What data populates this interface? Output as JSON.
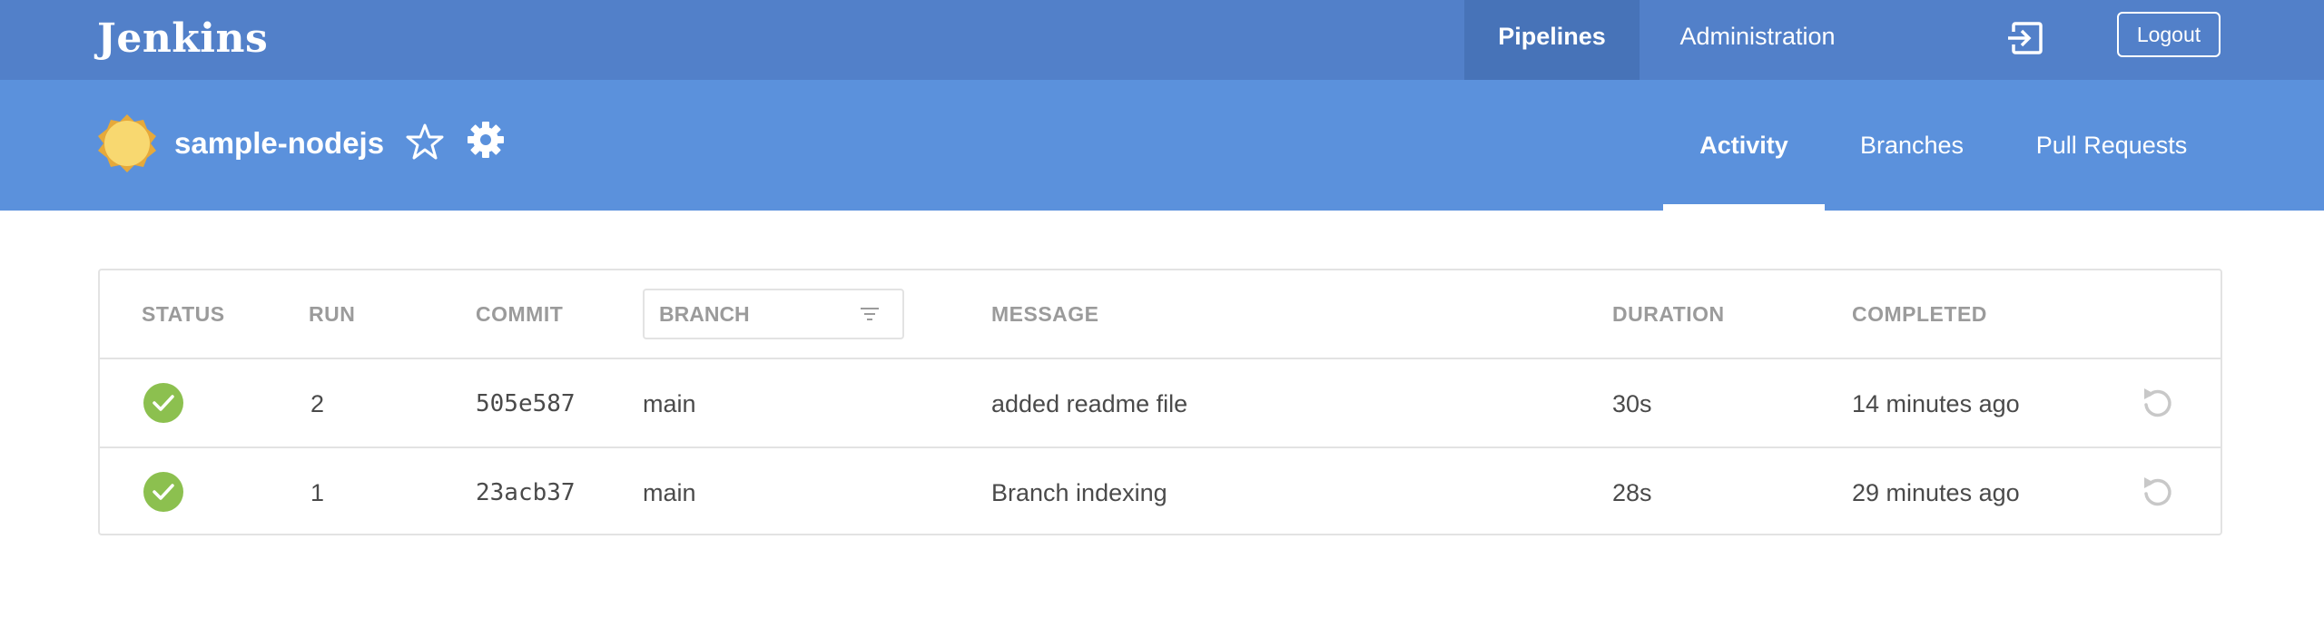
{
  "header": {
    "logo": "Jenkins",
    "nav": [
      {
        "label": "Pipelines"
      },
      {
        "label": "Administration"
      }
    ],
    "logout_label": "Logout",
    "brand_color": "#5280c9"
  },
  "pipeline": {
    "name": "sample-nodejs",
    "weather_icon": "sunny-weather-icon",
    "tabs": [
      {
        "label": "Activity",
        "active": true
      },
      {
        "label": "Branches",
        "active": false
      },
      {
        "label": "Pull Requests",
        "active": false
      }
    ],
    "accent_color": "#5b91dc"
  },
  "activity": {
    "columns": {
      "status": "STATUS",
      "run": "RUN",
      "commit": "COMMIT",
      "branch": "BRANCH",
      "message": "MESSAGE",
      "duration": "DURATION",
      "completed": "COMPLETED"
    },
    "rows": [
      {
        "status": "success",
        "run": "2",
        "commit": "505e587",
        "branch": "main",
        "message": "added readme file",
        "duration": "30s",
        "completed": "14 minutes ago"
      },
      {
        "status": "success",
        "run": "1",
        "commit": "23acb37",
        "branch": "main",
        "message": "Branch indexing",
        "duration": "28s",
        "completed": "29 minutes ago"
      }
    ],
    "success_color": "#8cc04f"
  }
}
